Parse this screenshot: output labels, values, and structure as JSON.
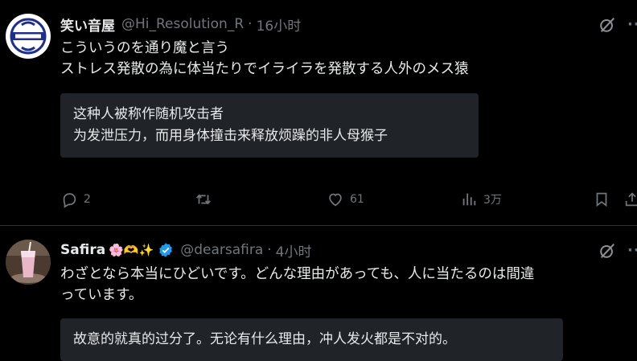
{
  "post1": {
    "name": "笑い音屋",
    "handle": "@Hi_Resolution_R",
    "sep": "·",
    "time": "16小时",
    "text_lines": [
      "こういうのを通り魔と言う",
      "ストレス発散の為に体当たりでイライラを発散する人外のメス猿"
    ],
    "translation_lines": [
      "这种人被称作随机攻击者",
      "为发泄压力，而用身体撞击来释放烦躁的非人母猴子"
    ],
    "replies": "2",
    "likes": "61",
    "views": "3万"
  },
  "post2": {
    "name": "Safira",
    "emojis": "🌸🫶✨",
    "handle": "@dearsafira",
    "sep": "·",
    "time": "4小时",
    "text_lines": [
      "わざとなら本当にひどいです。どんな理由があっても、人に当たるのは間違",
      "っています。"
    ],
    "translation_lines": [
      "故意的就真的过分了。无论有什么理由，冲人发火都是不对的。"
    ]
  },
  "colors": {
    "background": "#000000",
    "text": "#e7e9ea",
    "muted": "#71767b",
    "translation_bg": "#202327",
    "verified": "#1d9bf0",
    "divider": "#2f3336"
  }
}
